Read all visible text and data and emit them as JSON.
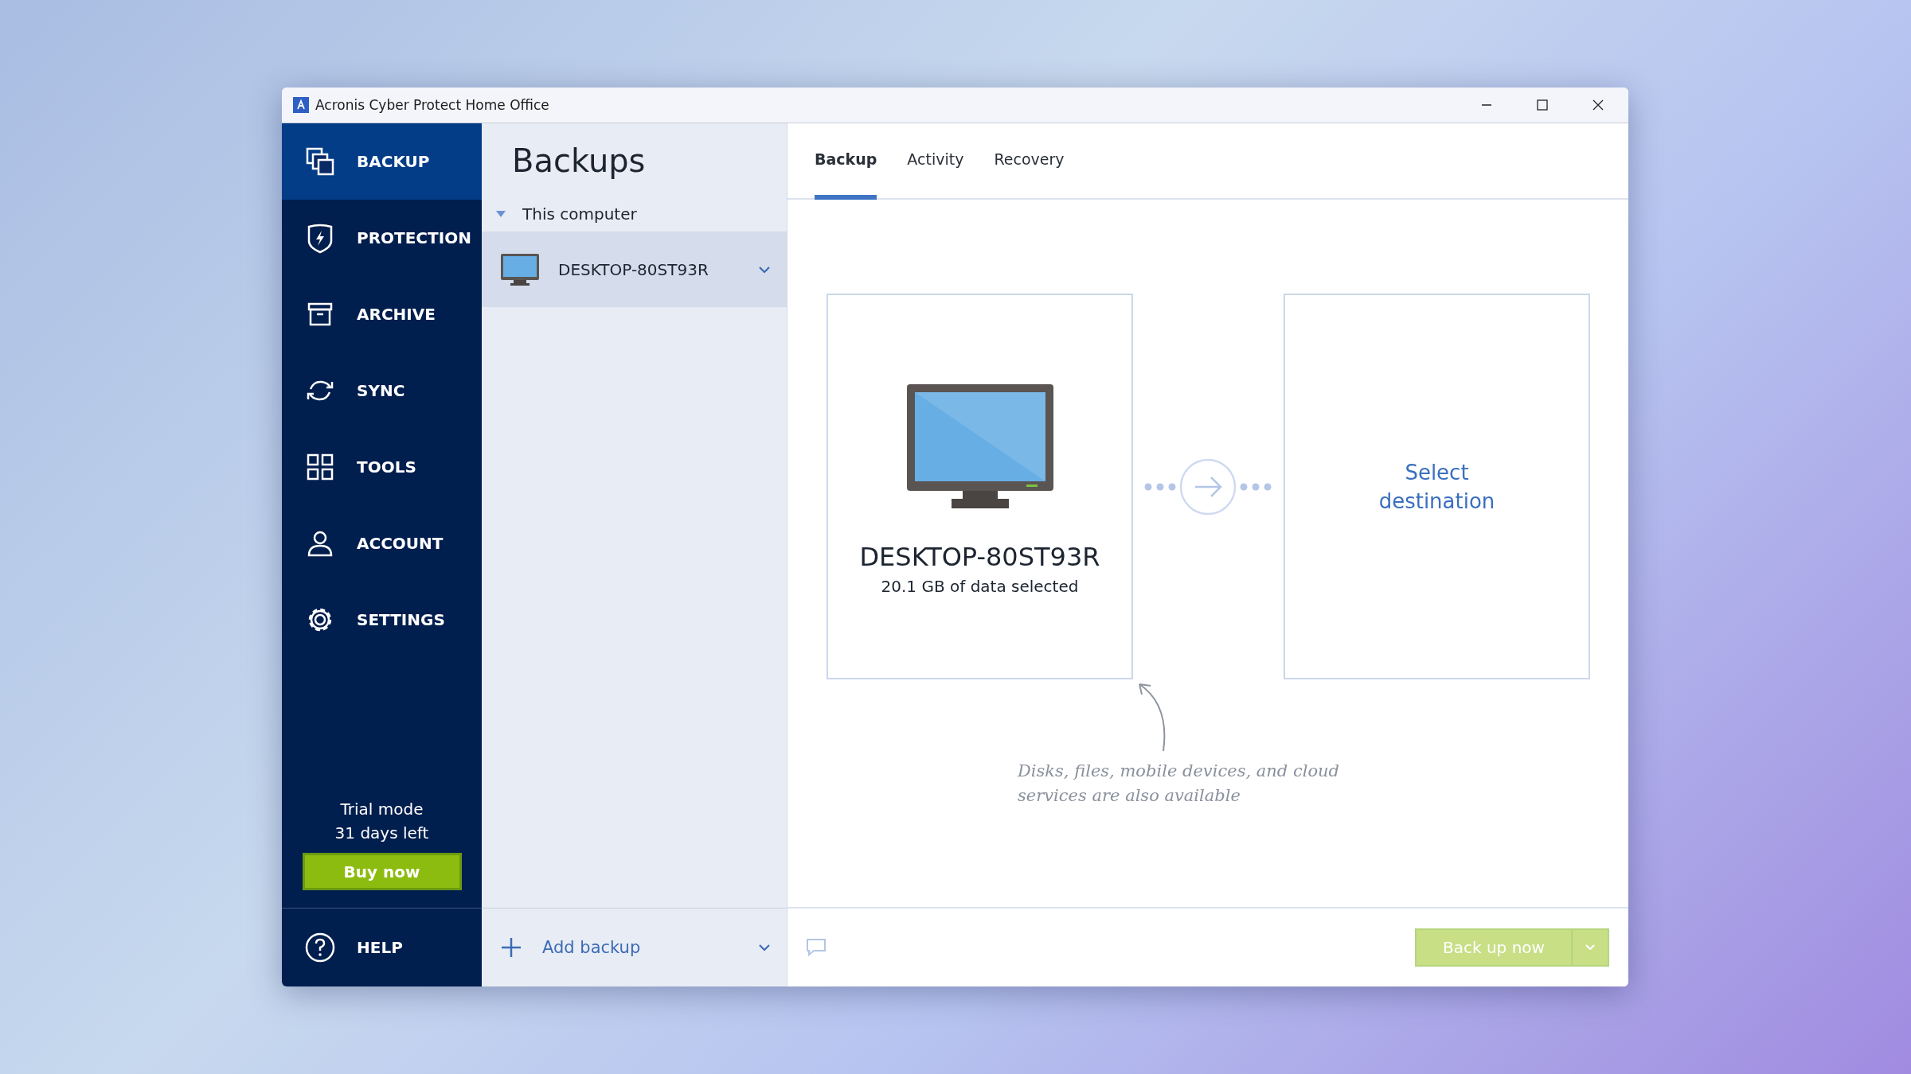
{
  "window": {
    "title": "Acronis Cyber Protect Home Office"
  },
  "nav": [
    {
      "kind": "backup",
      "label": "BACKUP",
      "selected": true
    },
    {
      "kind": "protection",
      "label": "PROTECTION",
      "selected": false
    },
    {
      "kind": "archive",
      "label": "ARCHIVE",
      "selected": false
    },
    {
      "kind": "sync",
      "label": "SYNC",
      "selected": false
    },
    {
      "kind": "tools",
      "label": "TOOLS",
      "selected": false
    },
    {
      "kind": "account",
      "label": "ACCOUNT",
      "selected": false
    },
    {
      "kind": "settings",
      "label": "SETTINGS",
      "selected": false
    }
  ],
  "trial": {
    "lines": [
      "Trial mode",
      "31 days left"
    ],
    "button": "Buy now"
  },
  "help": {
    "label": "HELP"
  },
  "backups_panel": {
    "title": "Backups",
    "group": {
      "label": "This computer",
      "expanded": true,
      "items": [
        {
          "name": "DESKTOP-80ST93R",
          "selected": true
        }
      ]
    },
    "add_button": "Add backup"
  },
  "tabs": [
    {
      "label": "Backup",
      "selected": true
    },
    {
      "label": "Activity",
      "selected": false
    },
    {
      "label": "Recovery",
      "selected": false
    }
  ],
  "source": {
    "name": "DESKTOP-80ST93R",
    "detail": "20.1 GB of data selected"
  },
  "destination": {
    "label": "Select destination"
  },
  "hint": "Disks, files, mobile devices, and cloud services are also available",
  "backup_button": {
    "label": "Back up now",
    "disabled": true
  }
}
